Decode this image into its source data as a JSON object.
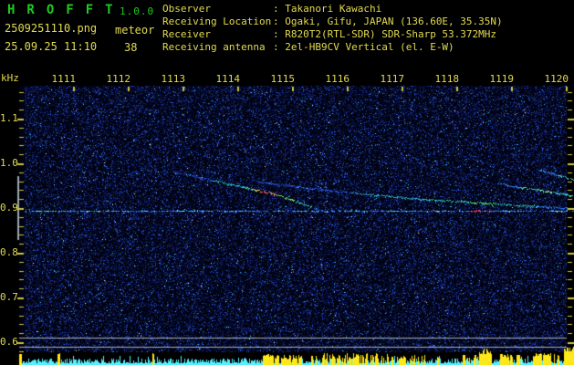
{
  "window": {
    "title": "HROFFT",
    "version": "1.0.0",
    "filename": "2509251110.png",
    "mode": "meteor",
    "datetime": "25.09.25 11:10",
    "echo_count": "38"
  },
  "info_panel": {
    "separator": ": ",
    "rows": [
      {
        "label": "Observer",
        "value": "Takanori Kawachi"
      },
      {
        "label": "Receiving Location",
        "value": "Ogaki, Gifu, JAPAN (136.60E, 35.35N)"
      },
      {
        "label": "Receiver",
        "value": "R820T2(RTL-SDR) SDR-Sharp 53.372MHz"
      },
      {
        "label": "Receiving antenna",
        "value": "2el-HB9CV Vertical (el. E-W)"
      }
    ]
  },
  "chart_data": {
    "type": "heatmap",
    "subtype": "radio-meteor-spectrogram",
    "x_axis": {
      "tick_labels": [
        "1111",
        "1112",
        "1113",
        "1114",
        "1115",
        "1116",
        "1117",
        "1118",
        "1119",
        "1120"
      ],
      "tick_offsets_min": [
        1,
        2,
        3,
        4,
        5,
        6,
        7,
        8,
        9,
        10
      ],
      "span_min": 10
    },
    "y_axis": {
      "label": "kHz",
      "tick_labels": [
        "1.1",
        "1.0",
        "0.9",
        "0.8",
        "0.7",
        "0.6"
      ],
      "minor_tick_step_khz": 0.02,
      "range_khz": [
        0.58,
        1.176
      ]
    },
    "carrier": {
      "khz": 0.894,
      "colors": [
        [
          0.3,
          "#1e4fd2"
        ],
        [
          0.55,
          "#2e7fff"
        ],
        [
          0.8,
          "#3fb4f0"
        ],
        [
          0.93,
          "#55e8ff"
        ],
        [
          1.01,
          "#8af2ff"
        ]
      ],
      "bright_segment_min": [
        0.28,
        0.78
      ],
      "red_segment_min": [
        8.23,
        8.6
      ],
      "red_colors": [
        [
          0.45,
          "#ff3a5c"
        ],
        [
          0.7,
          "#ff7a8a"
        ],
        [
          0.85,
          "#ffb347"
        ],
        [
          1.01,
          "#ffe066"
        ]
      ]
    },
    "reference_lines_khz": [
      0.611,
      0.59
    ],
    "freq_marker_range_khz": [
      0.829,
      0.971
    ],
    "meteor_traces": [
      {
        "name": "meteor-echo-1-head",
        "points_min_khz": [
          [
            2.82,
            0.982
          ],
          [
            4.7,
            0.931
          ],
          [
            5.65,
            0.89
          ]
        ],
        "color_stops": [
          [
            0,
            "#1b49d8"
          ],
          [
            0.25,
            "#27b9b0"
          ],
          [
            0.45,
            "#62e87a"
          ],
          [
            0.52,
            "#ffd23e"
          ],
          [
            0.56,
            "#ff4a5e"
          ],
          [
            0.6,
            "#ff9a3c"
          ],
          [
            0.66,
            "#7ce86a"
          ],
          [
            0.78,
            "#2fd8c8"
          ],
          [
            0.9,
            "#2f7bff"
          ],
          [
            1,
            "#2553d0"
          ]
        ]
      },
      {
        "name": "meteor-echo-1-trail",
        "points_min_khz": [
          [
            4.35,
            0.959
          ],
          [
            5.8,
            0.938
          ],
          [
            7.15,
            0.922
          ],
          [
            10.05,
            0.9
          ]
        ],
        "color_stops": [
          [
            0,
            "#2458e0"
          ],
          [
            0.3,
            "#2fb0d8"
          ],
          [
            0.55,
            "#37d8b8"
          ],
          [
            0.68,
            "#55ff66"
          ],
          [
            0.76,
            "#37d0c0"
          ],
          [
            0.9,
            "#2f7bff"
          ],
          [
            1,
            "#2050c8"
          ]
        ]
      },
      {
        "name": "meteor-echo-2",
        "points_min_khz": [
          [
            8.73,
            0.955
          ],
          [
            10.1,
            0.929
          ]
        ],
        "color_stops": [
          [
            0,
            "#2f8bff"
          ],
          [
            0.3,
            "#3fd8c0"
          ],
          [
            0.55,
            "#7cf0a8"
          ],
          [
            0.75,
            "#3fd8e0"
          ],
          [
            1,
            "#2f7bff"
          ]
        ]
      },
      {
        "name": "meteor-echo-3",
        "points_min_khz": [
          [
            9.48,
            0.986
          ],
          [
            10.13,
            0.965
          ]
        ],
        "color_stops": [
          [
            0,
            "#2f8bff"
          ],
          [
            0.5,
            "#45e0c8"
          ],
          [
            1,
            "#55ffd8"
          ]
        ]
      }
    ],
    "noise": {
      "seed": 1337,
      "density": 0.3,
      "palette": [
        [
          0.38,
          "#0a1342"
        ],
        [
          0.62,
          "#0f1d63"
        ],
        [
          0.78,
          "#172b8f"
        ],
        [
          0.88,
          "#2140c4"
        ],
        [
          0.95,
          "#3057e8"
        ],
        [
          0.985,
          "#2e7fff"
        ],
        [
          0.996,
          "#38d8f8"
        ],
        [
          1.01,
          "#dceeff"
        ]
      ],
      "bright_dot_colors": [
        "#44ff88",
        "#3ae8e0",
        "#7af0ff",
        "#c8ff70"
      ]
    },
    "signal_bar": {
      "cyan_color": "#55f0ff",
      "yellow_color": "#ffe81a",
      "yellow_clusters_min": [
        [
          0.0,
          0.04,
          1.0,
          12,
          14
        ],
        [
          0.7,
          0.74,
          1.0,
          12,
          14
        ],
        [
          2.42,
          2.46,
          1.0,
          12,
          14
        ],
        [
          4.45,
          4.68,
          0.9,
          8,
          13
        ],
        [
          4.68,
          5.18,
          0.8,
          6,
          12
        ],
        [
          5.32,
          5.42,
          0.65,
          9,
          13
        ],
        [
          5.52,
          6.55,
          0.75,
          7,
          14
        ],
        [
          6.55,
          6.92,
          0.5,
          8,
          13
        ],
        [
          6.92,
          7.43,
          0.45,
          7,
          12
        ],
        [
          7.62,
          7.68,
          0.6,
          8,
          11
        ],
        [
          8.08,
          8.22,
          0.8,
          8,
          12
        ],
        [
          8.3,
          8.38,
          0.7,
          8,
          12
        ],
        [
          8.4,
          8.62,
          0.95,
          12,
          20
        ],
        [
          8.78,
          9.02,
          0.8,
          8,
          13
        ],
        [
          9.08,
          9.18,
          0.6,
          9,
          12
        ],
        [
          9.38,
          9.72,
          0.85,
          9,
          14
        ],
        [
          9.75,
          9.88,
          0.7,
          9,
          13
        ],
        [
          9.95,
          10.13,
          0.95,
          14,
          21
        ]
      ]
    }
  },
  "colors": {
    "background": "#000000",
    "title_green": "#1ecc1e",
    "text_yellow": "#e2da52",
    "tick_yellow": "#cfc63e",
    "gray_line": "#a8b0b8",
    "marker_gray": "#9aa6ad",
    "spectrogram_bg": "#010312"
  }
}
